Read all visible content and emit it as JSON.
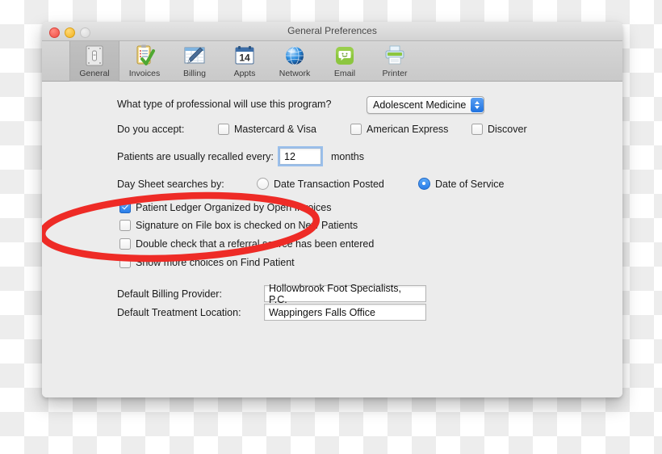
{
  "window": {
    "title": "General Preferences",
    "controls": [
      {
        "name": "close",
        "color": "#f04b42"
      },
      {
        "name": "minimize",
        "color": "#f2b21d"
      },
      {
        "name": "zoom",
        "color": "#d7d7d7"
      }
    ]
  },
  "toolbar": {
    "items": [
      {
        "label": "General",
        "icon": "light-switch-icon",
        "selected": true
      },
      {
        "label": "Invoices",
        "icon": "clipboard-checkmark-icon",
        "selected": false
      },
      {
        "label": "Billing",
        "icon": "spreadsheet-pen-icon",
        "selected": false
      },
      {
        "label": "Appts",
        "icon": "calendar-icon",
        "selected": false,
        "badge": "14"
      },
      {
        "label": "Network",
        "icon": "globe-icon",
        "selected": false
      },
      {
        "label": "Email",
        "icon": "message-bubble-icon",
        "selected": false
      },
      {
        "label": "Printer",
        "icon": "printer-icon",
        "selected": false
      }
    ]
  },
  "form": {
    "profession": {
      "label": "What type of professional will use this program?",
      "value": "Adolescent Medicine"
    },
    "accept": {
      "label": "Do you accept:",
      "options": [
        {
          "label": "Mastercard & Visa",
          "checked": false
        },
        {
          "label": "American Express",
          "checked": false
        },
        {
          "label": "Discover",
          "checked": false
        }
      ]
    },
    "recall": {
      "label": "Patients are usually recalled every:",
      "value": "12",
      "unit": "months"
    },
    "day_sheet": {
      "label": "Day Sheet searches by:",
      "options": [
        {
          "label": "Date Transaction Posted",
          "selected": false
        },
        {
          "label": "Date of Service",
          "selected": true
        }
      ]
    },
    "checkboxes": [
      {
        "label": "Patient Ledger Organized by Open Invoices",
        "checked": true
      },
      {
        "label": "Signature on File box is checked on New Patients",
        "checked": false
      },
      {
        "label": "Double check that a referral source has been entered",
        "checked": false
      },
      {
        "label": "Show more choices on Find Patient",
        "checked": false
      }
    ],
    "defaults": [
      {
        "label": "Default Billing Provider:",
        "value": "Hollowbrook Foot Specialists, P.C."
      },
      {
        "label": "Default Treatment Location:",
        "value": "Wappingers Falls Office"
      }
    ]
  },
  "annotation": {
    "shape": "red-ellipse-highlight",
    "color": "#ee2b26"
  }
}
